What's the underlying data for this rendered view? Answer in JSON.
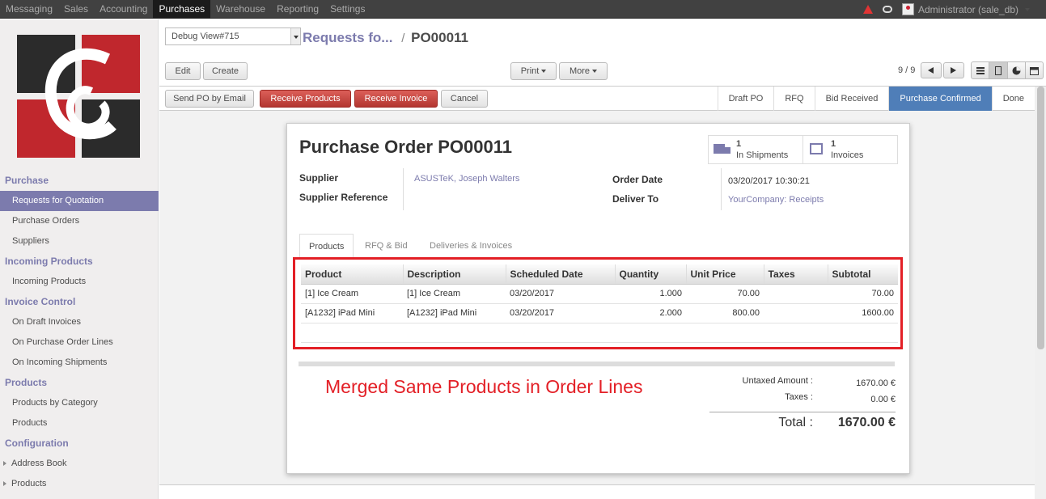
{
  "topnav": {
    "items": [
      "Messaging",
      "Sales",
      "Accounting",
      "Purchases",
      "Warehouse",
      "Reporting",
      "Settings"
    ],
    "active": "Purchases",
    "user": "Administrator (sale_db)"
  },
  "sidebar": {
    "sections": [
      {
        "header": "Purchase",
        "items": [
          "Requests for Quotation",
          "Purchase Orders",
          "Suppliers"
        ]
      },
      {
        "header": "Incoming Products",
        "items": [
          "Incoming Products"
        ]
      },
      {
        "header": "Invoice Control",
        "items": [
          "On Draft Invoices",
          "On Purchase Order Lines",
          "On Incoming Shipments"
        ]
      },
      {
        "header": "Products",
        "items": [
          "Products by Category",
          "Products"
        ]
      },
      {
        "header": "Configuration",
        "items": [
          "Address Book",
          "Products"
        ]
      }
    ],
    "selected": "Requests for Quotation"
  },
  "control_panel": {
    "debug_select": "Debug View#715",
    "breadcrumb_link": "Requests fo...",
    "breadcrumb_sep": "/",
    "breadcrumb_current": "PO00011",
    "edit": "Edit",
    "create": "Create",
    "print": "Print",
    "more": "More",
    "pager": "9 / 9"
  },
  "statusbar": {
    "buttons": [
      "Send PO by Email",
      "Receive Products",
      "Receive Invoice",
      "Cancel"
    ],
    "stages": [
      "Draft PO",
      "RFQ",
      "Bid Received",
      "Purchase Confirmed",
      "Done"
    ],
    "current_stage": "Purchase Confirmed"
  },
  "sheet": {
    "title_prefix": "Purchase Order",
    "title_number": "PO00011",
    "smart_buttons": [
      {
        "count": "1",
        "label": "In Shipments",
        "icon": "truck-icon"
      },
      {
        "count": "1",
        "label": "Invoices",
        "icon": "pencil-square-icon"
      }
    ],
    "supplier_label": "Supplier",
    "supplier_value": "ASUSTeK, Joseph Walters",
    "supplier_ref_label": "Supplier Reference",
    "order_date_label": "Order Date",
    "order_date_value": "03/20/2017 10:30:21",
    "deliver_to_label": "Deliver To",
    "deliver_to_value": "YourCompany: Receipts",
    "tabs": [
      "Products",
      "RFQ & Bid",
      "Deliveries & Invoices"
    ],
    "columns": [
      "Product",
      "Description",
      "Scheduled Date",
      "Quantity",
      "Unit Price",
      "Taxes",
      "Subtotal"
    ],
    "lines": [
      {
        "product": "[1] Ice Cream",
        "description": "[1] Ice Cream",
        "date": "03/20/2017",
        "qty": "1.000",
        "price": "70.00",
        "taxes": "",
        "subtotal": "70.00"
      },
      {
        "product": "[A1232] iPad Mini",
        "description": "[A1232] iPad Mini",
        "date": "03/20/2017",
        "qty": "2.000",
        "price": "800.00",
        "taxes": "",
        "subtotal": "1600.00"
      }
    ],
    "annotation": "Merged Same Products in Order Lines",
    "untaxed_label": "Untaxed Amount :",
    "untaxed_value": "1670.00 €",
    "taxes_label": "Taxes :",
    "taxes_value": "0.00 €",
    "total_label": "Total :",
    "total_value": "1670.00 €"
  },
  "colors": {
    "accent": "#7c7bad",
    "danger": "#e31f26",
    "stage": "#4f7eb8"
  }
}
